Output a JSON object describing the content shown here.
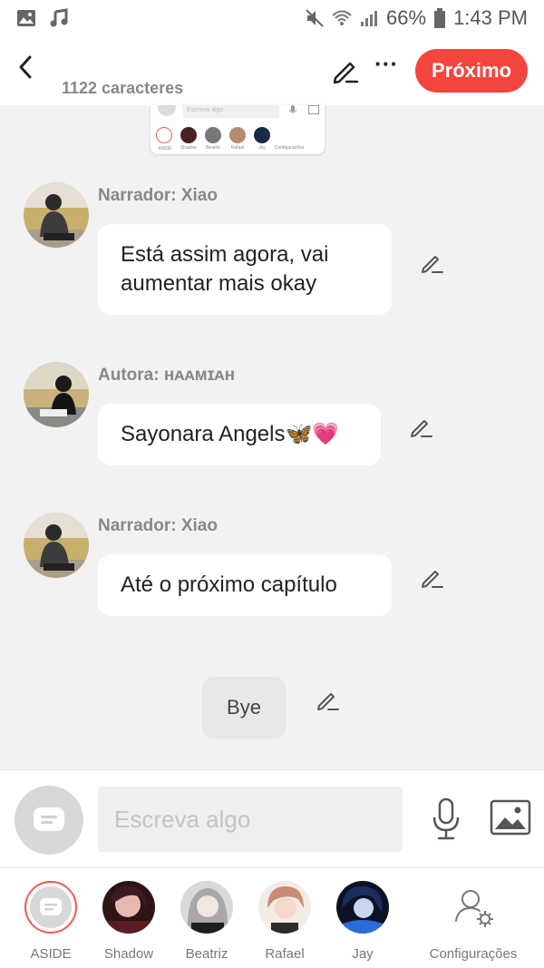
{
  "status_bar": {
    "battery": "66%",
    "time": "1:43 PM"
  },
  "header": {
    "char_count": "1122 caracteres",
    "next_label": "Próximo"
  },
  "preview": {
    "input_placeholder": "Escreva algo",
    "characters": [
      "ASIDE",
      "Shadow",
      "Beatriz",
      "Rafael",
      "Jay",
      "Configurações"
    ]
  },
  "messages": [
    {
      "name": "Narrador: Xiao",
      "text": "Está assim agora, vai aumentar mais okay"
    },
    {
      "name": "Autora: ʜᴀᴀᴍɪᴀʜ",
      "text": "Sayonara Angels🦋💗"
    },
    {
      "name": "Narrador: Xiao",
      "text": "Até o próximo capítulo"
    }
  ],
  "narration": {
    "text": "Bye"
  },
  "input": {
    "placeholder": "Escreva algo"
  },
  "characters": [
    {
      "label": "ASIDE"
    },
    {
      "label": "Shadow"
    },
    {
      "label": "Beatriz"
    },
    {
      "label": "Rafael"
    },
    {
      "label": "Jay"
    },
    {
      "label": "Configurações"
    }
  ],
  "colors": {
    "accent": "#f5453f",
    "background": "#f2f2f2"
  }
}
